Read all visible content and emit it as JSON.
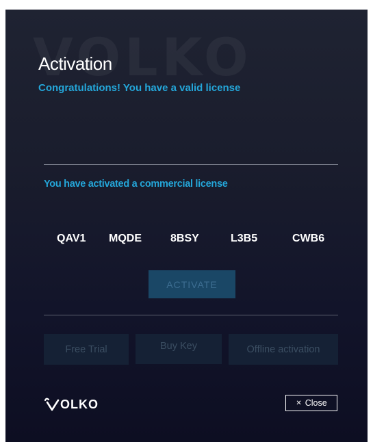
{
  "dialog": {
    "watermark": "VOLKO",
    "title": "Activation",
    "subtitle": "Congratulations! You have a valid license",
    "status": "You have activated a commercial license",
    "key_segments": [
      "QAV1",
      "MQDE",
      "8BSY",
      "L3B5",
      "CWB6"
    ],
    "activate_label": "ACTIVATE",
    "buttons": {
      "free_trial": "Free Trial",
      "buy_key": "Buy Key",
      "offline": "Offline activation"
    },
    "logo_text": "OLKO",
    "close_label": "Close",
    "icons": {
      "close": "close-icon",
      "logo": "volko-logo-icon"
    }
  },
  "colors": {
    "accent": "#24a6d9",
    "activate_bg": "#1a4766",
    "button_bg": "#152135"
  }
}
